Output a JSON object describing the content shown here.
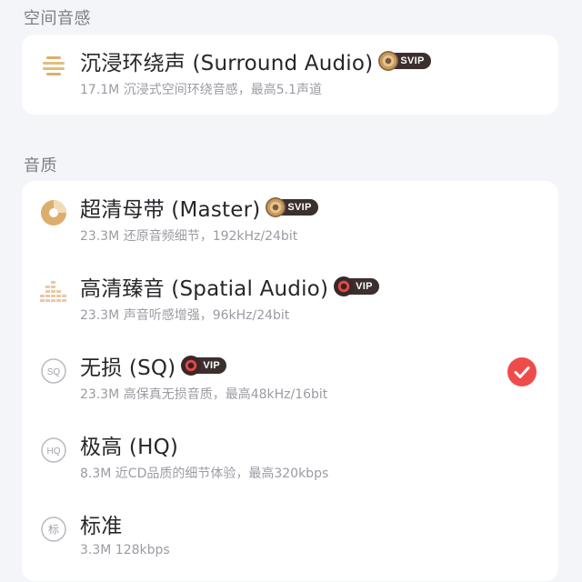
{
  "sections": {
    "spatial": {
      "title": "空间音感"
    },
    "quality": {
      "title": "音质"
    }
  },
  "items": [
    {
      "title": "沉浸环绕声 (Surround Audio)",
      "subtitle": "17.1M  沉浸式空间环绕音感，最高5.1声道",
      "badge": "SVIP",
      "icon": "surround-audio-icon"
    },
    {
      "title": "超清母带 (Master)",
      "subtitle": "23.3M  还原音频细节，192kHz/24bit",
      "badge": "SVIP",
      "icon": "master-disc-icon"
    },
    {
      "title": "高清臻音 (Spatial Audio)",
      "subtitle": "23.3M  声音听感增强，96kHz/24bit",
      "badge": "VIP",
      "icon": "spatial-audio-bars-icon"
    },
    {
      "title": "无损 (SQ)",
      "subtitle": "23.3M  高保真无损音质，最高48kHz/16bit",
      "badge": "VIP",
      "icon": "sq-icon",
      "selected": true
    },
    {
      "title": "极高 (HQ)",
      "subtitle": "8.3M  近CD品质的细节体验，最高320kbps",
      "icon": "hq-icon"
    },
    {
      "title": "标准",
      "subtitle": "3.3M  128kbps",
      "icon": "standard-icon"
    }
  ],
  "icon_text": {
    "sq": "SQ",
    "hq": "HQ",
    "standard": "标"
  },
  "colors": {
    "accent_red": "#f04b4b",
    "gold": "#d9a968"
  }
}
